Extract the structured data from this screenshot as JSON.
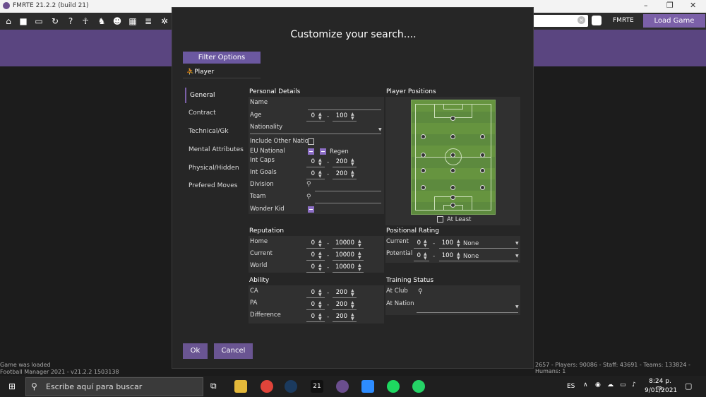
{
  "window": {
    "title": "FMRTE 21.2.2 (build 21)"
  },
  "header": {
    "brand_label": "FMRTE",
    "load_game_label": "Load Game"
  },
  "status": {
    "line1": "Game was loaded",
    "line2": "Football Manager 2021 - v21.2.2 1503138",
    "stats": "2657 - Players: 90086 - Staff: 43691 - Teams: 133824 - Humans: 1"
  },
  "dialog": {
    "title": "Customize your search....",
    "filter_options_label": "Filter Options",
    "player_tab_label": "Player",
    "nav": [
      "General",
      "Contract",
      "Technical/Gk",
      "Mental Attributes",
      "Physical/Hidden",
      "Prefered Moves"
    ],
    "personal": {
      "header": "Personal Details",
      "name_label": "Name",
      "age_label": "Age",
      "age_min": "0",
      "age_max": "100",
      "nationality_label": "Nationality",
      "include_other_label": "Include Other Natio",
      "eu_label": "EU National",
      "regen_label": "Regen",
      "intcaps_label": "Int Caps",
      "intcaps_min": "0",
      "intcaps_max": "200",
      "intgoals_label": "Int Goals",
      "intgoals_min": "0",
      "intgoals_max": "200",
      "division_label": "Division",
      "team_label": "Team",
      "wonderkid_label": "Wonder Kid"
    },
    "positions": {
      "header": "Player Positions",
      "at_least_label": "At Least"
    },
    "reputation": {
      "header": "Reputation",
      "home_label": "Home",
      "home_min": "0",
      "home_max": "10000",
      "current_label": "Current",
      "current_min": "0",
      "current_max": "10000",
      "world_label": "World",
      "world_min": "0",
      "world_max": "10000"
    },
    "positional_rating": {
      "header": "Positional Rating",
      "current_label": "Current",
      "current_min": "0",
      "current_max": "100",
      "current_sel": "None",
      "potential_label": "Potential",
      "potential_min": "0",
      "potential_max": "100",
      "potential_sel": "None"
    },
    "ability": {
      "header": "Ability",
      "ca_label": "CA",
      "ca_min": "0",
      "ca_max": "200",
      "pa_label": "PA",
      "pa_min": "0",
      "pa_max": "200",
      "diff_label": "Difference",
      "diff_min": "0",
      "diff_max": "200"
    },
    "training": {
      "header": "Training Status",
      "club_label": "At Club",
      "nation_label": "At Nation"
    },
    "ok_label": "Ok",
    "cancel_label": "Cancel"
  },
  "taskbar": {
    "search_placeholder": "Escribe aquí para buscar",
    "app21_label": "21",
    "lang": "ES",
    "time": "8:24 p. m.",
    "date": "9/01/2021"
  },
  "colors": {
    "accent": "#7b60a8",
    "header_bar": "#5a4580",
    "pitch": "#5d8a3e"
  }
}
